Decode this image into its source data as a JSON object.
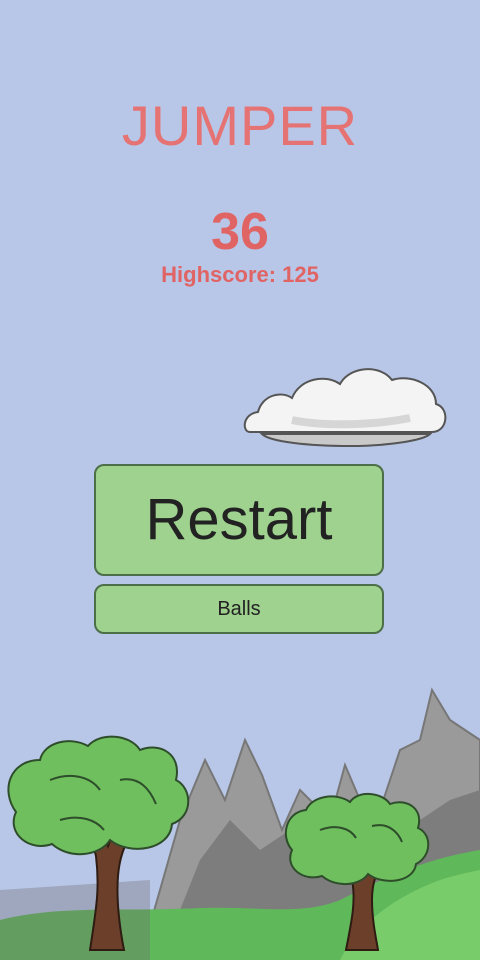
{
  "game": {
    "title": "JUMPER",
    "score": "36",
    "highscore_label": "Highscore:",
    "highscore_value": "125"
  },
  "buttons": {
    "restart_label": "Restart",
    "balls_label": "Balls"
  },
  "colors": {
    "sky": "#b8c7e8",
    "title_red": "#e57373",
    "button_green": "#9fd28f",
    "button_border": "#4c6f48",
    "mountain": "#9a9a9a",
    "grass": "#5fb85a",
    "foliage": "#6fbf5f",
    "trunk": "#6b3f2a"
  }
}
